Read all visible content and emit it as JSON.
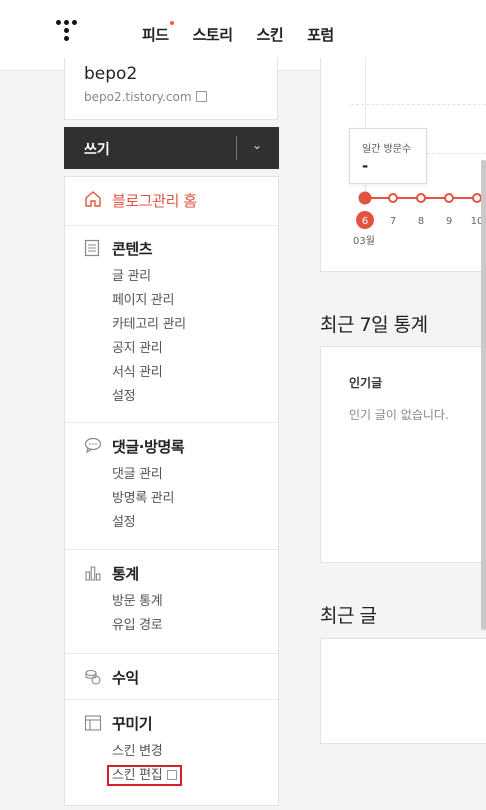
{
  "nav": {
    "items": [
      {
        "label": "피드",
        "has_dot": true
      },
      {
        "label": "스토리"
      },
      {
        "label": "스킨"
      },
      {
        "label": "포럼"
      }
    ]
  },
  "profile": {
    "name": "bepo2",
    "url": "bepo2.tistory.com"
  },
  "write": {
    "label": "쓰기"
  },
  "menu": {
    "home": "블로그관리 홈",
    "content": {
      "title": "콘텐츠",
      "items": [
        "글 관리",
        "페이지 관리",
        "카테고리 관리",
        "공지 관리",
        "서식 관리",
        "설정"
      ]
    },
    "comments": {
      "title": "댓글·방명록",
      "items": [
        "댓글 관리",
        "방명록 관리",
        "설정"
      ]
    },
    "stats": {
      "title": "통계",
      "items": [
        "방문 통계",
        "유입 경로"
      ]
    },
    "revenue": {
      "title": "수익"
    },
    "design": {
      "title": "꾸미기",
      "items": [
        "스킨 변경",
        "스킨 편집"
      ]
    }
  },
  "chart": {
    "tooltip_title": "일간 방문수",
    "tooltip_value": "-",
    "month_label": "03월"
  },
  "chart_data": {
    "type": "line",
    "categories": [
      "6",
      "7",
      "8",
      "9",
      "10"
    ],
    "values": [
      0,
      0,
      0,
      0,
      0
    ],
    "highlight_index": 0,
    "title": "",
    "xlabel": "",
    "ylabel": "",
    "accent": "#e2543f"
  },
  "recent7": {
    "title": "최근 7일 통계",
    "popular_title": "인기글",
    "popular_empty": "인기 글이 없습니다."
  },
  "recent_posts": {
    "title": "최근 글"
  },
  "colors": {
    "accent": "#e2543f",
    "dark_bar": "#303030",
    "highlight_box": "#d5202f"
  }
}
